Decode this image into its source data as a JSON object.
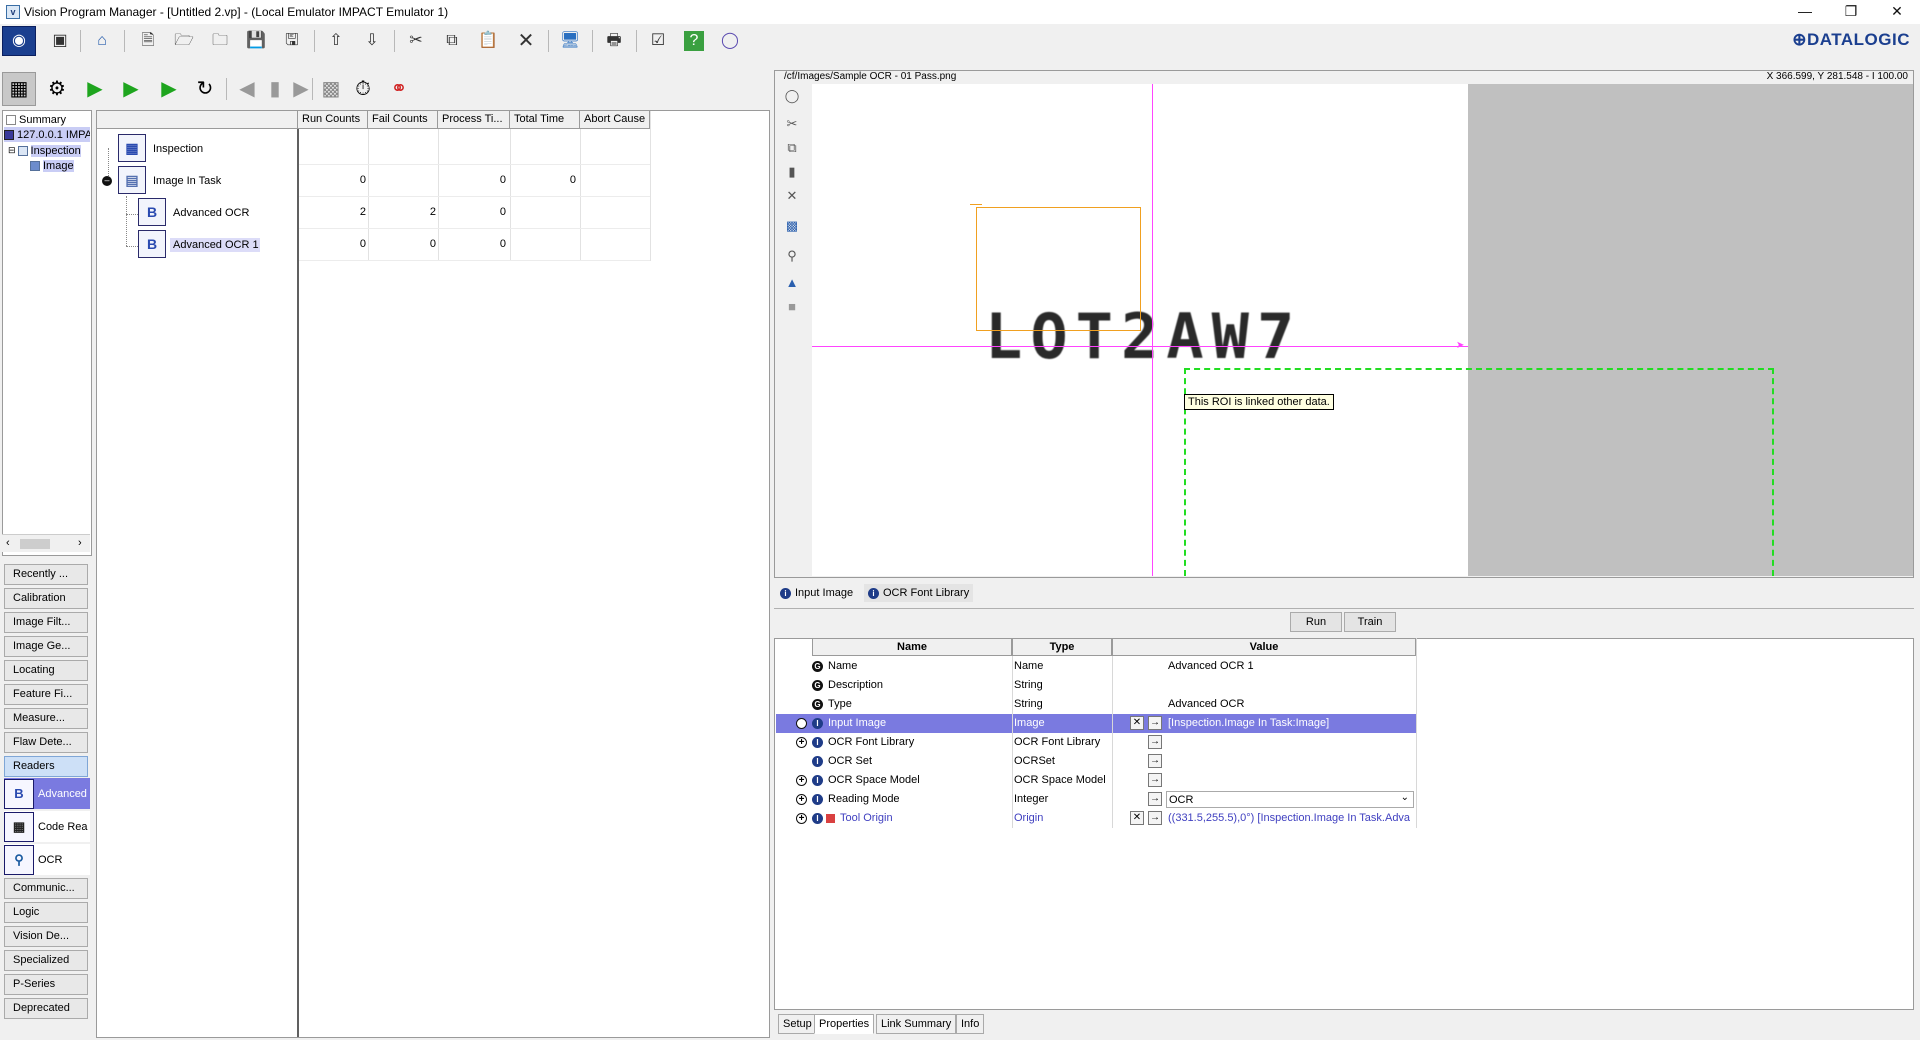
{
  "window": {
    "title": "Vision Program Manager - [Untitled 2.vp] - (Local Emulator IMPACT Emulator 1)",
    "app_icon": "vpm-app-icon",
    "brand": "⊕DATALOGIC"
  },
  "left_tree": {
    "items": [
      {
        "label": "Summary"
      },
      {
        "label": "127.0.0.1 IMPA"
      },
      {
        "label": "Inspection"
      },
      {
        "label": "Image"
      }
    ]
  },
  "categories": [
    {
      "label": "Recently ..."
    },
    {
      "label": "Calibration"
    },
    {
      "label": "Image Filt..."
    },
    {
      "label": "Image Ge..."
    },
    {
      "label": "Locating"
    },
    {
      "label": "Feature Fi..."
    },
    {
      "label": "Measure..."
    },
    {
      "label": "Flaw Dete..."
    },
    {
      "label": "Readers"
    }
  ],
  "reader_tools": [
    {
      "label": "Advanced",
      "icon": "advanced-ocr-icon"
    },
    {
      "label": "Code Rea",
      "icon": "code-reader-icon"
    },
    {
      "label": "OCR",
      "icon": "ocr-icon"
    }
  ],
  "categories_after": [
    {
      "label": "Communic..."
    },
    {
      "label": "Logic"
    },
    {
      "label": "Vision De..."
    },
    {
      "label": "Specialized"
    },
    {
      "label": "P-Series"
    },
    {
      "label": "Deprecated"
    }
  ],
  "task_grid": {
    "columns": [
      "Run Counts",
      "Fail Counts",
      "Process Ti...",
      "Total Time",
      "Abort Cause"
    ],
    "rows": [
      {
        "label": "Inspection",
        "run": "",
        "fail": "",
        "process": "",
        "total": "",
        "abort": ""
      },
      {
        "label": "Image In Task",
        "run": "0",
        "fail": "",
        "process": "0",
        "total": "0",
        "abort": ""
      },
      {
        "label": "Advanced OCR",
        "run": "2",
        "fail": "2",
        "process": "0",
        "total": "",
        "abort": ""
      },
      {
        "label": "Advanced OCR 1",
        "run": "0",
        "fail": "0",
        "process": "0",
        "total": "",
        "abort": ""
      }
    ]
  },
  "viewer": {
    "path": "/cf/Images/Sample OCR - 01 Pass.png",
    "coords": "X 366.599,  Y 281.548  -  I 100.00",
    "ocr_text": "LOT2AW7",
    "tooltip": "This ROI is linked other data."
  },
  "viewer_tabs": [
    {
      "label": "Input Image"
    },
    {
      "label": "OCR Font Library"
    }
  ],
  "actions": {
    "run": "Run",
    "train": "Train"
  },
  "properties": {
    "headers": {
      "name": "Name",
      "type": "Type",
      "value": "Value"
    },
    "rows": [
      {
        "name": "Name",
        "type": "Name",
        "value": "Advanced OCR 1"
      },
      {
        "name": "Description",
        "type": "String",
        "value": ""
      },
      {
        "name": "Type",
        "type": "String",
        "value": "Advanced OCR"
      },
      {
        "name": "Input Image",
        "type": "Image",
        "value": "[Inspection.Image In Task:Image]"
      },
      {
        "name": "OCR Font Library",
        "type": "OCR Font Library",
        "value": ""
      },
      {
        "name": "OCR Set",
        "type": "OCRSet",
        "value": ""
      },
      {
        "name": "OCR Space Model",
        "type": "OCR Space Model",
        "value": ""
      },
      {
        "name": "Reading Mode",
        "type": "Integer",
        "value": "OCR"
      },
      {
        "name": "Tool Origin",
        "type": "Origin",
        "value": "((331.5,255.5),0°) [Inspection.Image In Task.Adva"
      }
    ]
  },
  "bottom_tabs": [
    {
      "label": "Setup"
    },
    {
      "label": "Properties"
    },
    {
      "label": "Link Summary"
    },
    {
      "label": "Info"
    }
  ],
  "colors": {
    "selection": "#7a7ae0",
    "brand": "#1b3f8f",
    "roi_orange": "#f0a020",
    "roi_green": "#22dd22",
    "crosshair": "#ff44ff"
  }
}
